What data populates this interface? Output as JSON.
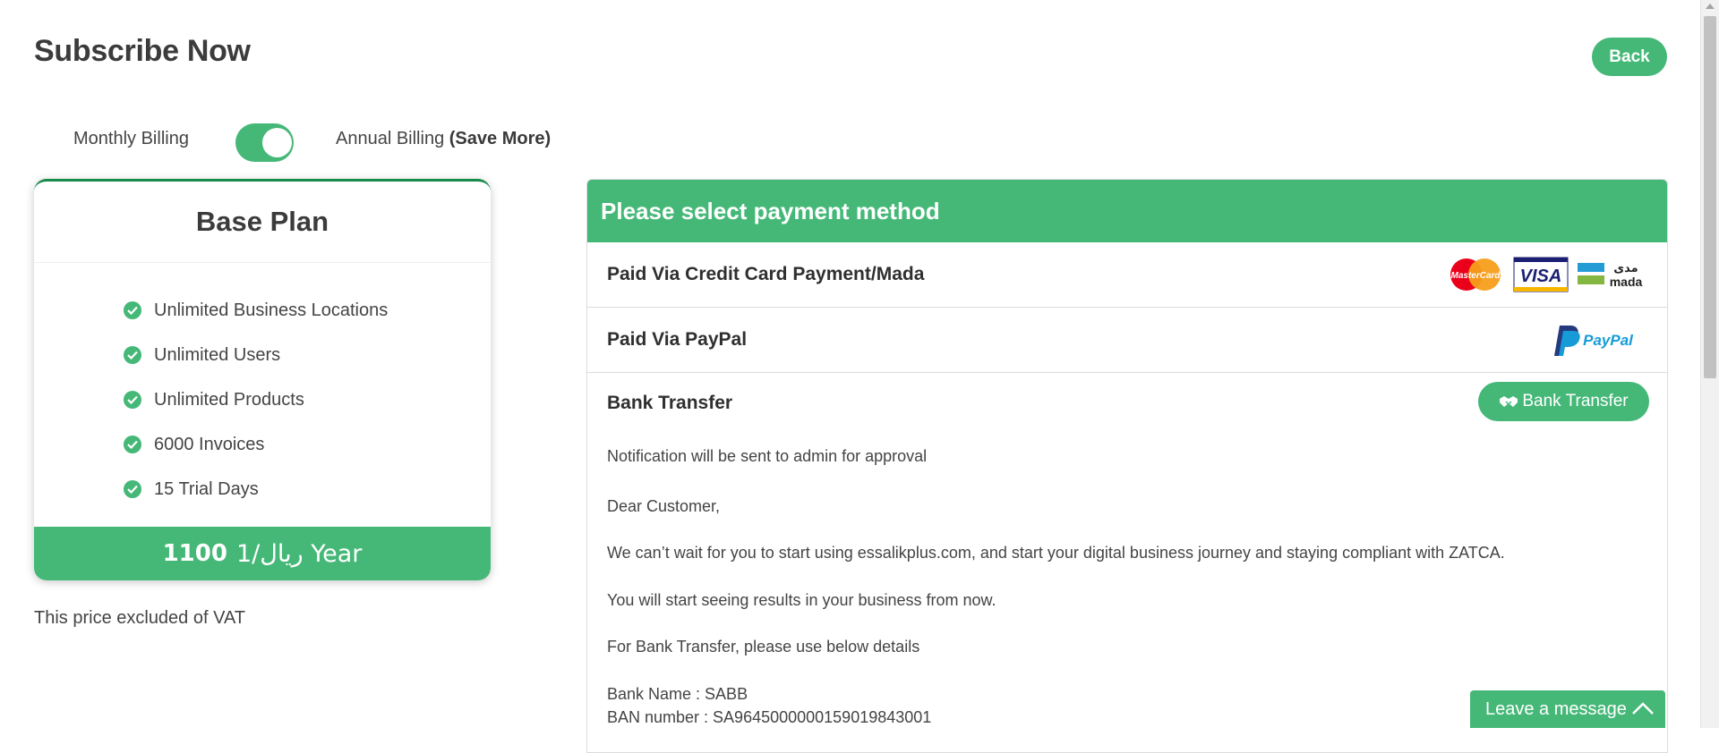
{
  "header": {
    "title": "Subscribe Now",
    "back_label": "Back"
  },
  "billing": {
    "monthly_label": "Monthly Billing",
    "annual_label": "Annual Billing",
    "annual_note": "(Save More)",
    "annual_selected": true
  },
  "plan": {
    "name": "Base Plan",
    "features": [
      "Unlimited Business Locations",
      "Unlimited Users",
      "Unlimited Products",
      "6000 Invoices",
      "15 Trial Days"
    ],
    "price_amount": "1100",
    "price_currency": "ريال",
    "price_period": "/1 Year",
    "vat_note": "This price excluded of VAT"
  },
  "payment": {
    "header": "Please select payment method",
    "options": [
      {
        "label": "Paid Via Credit Card Payment/Mada",
        "logos": [
          "MasterCard",
          "VISA",
          "مدى",
          "mada"
        ]
      },
      {
        "label": "Paid Via PayPal",
        "logos": [
          "PayPal"
        ]
      }
    ],
    "bank": {
      "title": "Bank Transfer",
      "button_label": "Bank Transfer",
      "lines": [
        "Notification will be sent to admin for approval",
        "Dear Customer,",
        "We can’t wait for you to start using essalikplus.com, and start your digital business journey and staying compliant with ZATCA.",
        "You will start seeing results in your business from now.",
        "For Bank Transfer, please use below details",
        "Bank Name : SABB",
        "BAN number : SA9645000000159019843001"
      ]
    }
  },
  "chat": {
    "label": "Leave a message"
  },
  "colors": {
    "accent": "#45b878",
    "dark_accent": "#178a4c",
    "text": "#3a3a3a"
  }
}
